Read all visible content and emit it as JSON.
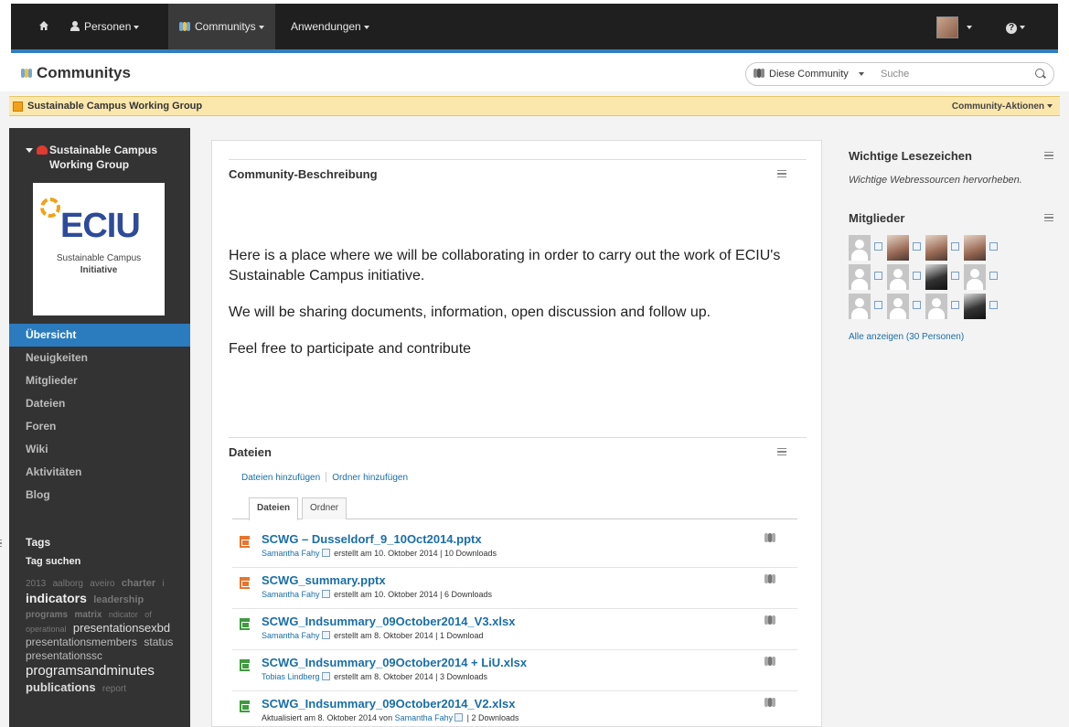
{
  "nav": {
    "items": [
      "Personen",
      "Communitys",
      "Anwendungen"
    ],
    "help_label": "?"
  },
  "header": {
    "title": "Communitys",
    "search_scope": "Diese Community",
    "search_placeholder": "Suche"
  },
  "banner": {
    "community_name": "Sustainable Campus Working Group",
    "actions_label": "Community-Aktionen"
  },
  "sidebar": {
    "community_title": "Sustainable Campus Working Group",
    "logo": {
      "brand": "ECIU",
      "line1": "Sustainable Campus",
      "line2": "Initiative"
    },
    "nav": [
      "Übersicht",
      "Neuigkeiten",
      "Mitglieder",
      "Dateien",
      "Foren",
      "Wiki",
      "Aktivitäten",
      "Blog"
    ],
    "tags_heading": "Tags",
    "tag_search": "Tag suchen",
    "tags": [
      {
        "t": "2013",
        "s": 10
      },
      {
        "t": "aalborg",
        "s": 10
      },
      {
        "t": "aveiro",
        "s": 10
      },
      {
        "t": "charter",
        "s": 11,
        "b": true
      },
      {
        "t": "i",
        "s": 10
      },
      {
        "t": "indicators",
        "s": 14,
        "b": true,
        "c": "#eee"
      },
      {
        "t": "leadership",
        "s": 11,
        "b": true
      },
      {
        "t": "programs",
        "s": 10,
        "b": true
      },
      {
        "t": "matrix",
        "s": 10,
        "b": true
      },
      {
        "t": "ndicator",
        "s": 9
      },
      {
        "t": "of",
        "s": 9
      },
      {
        "t": "operational",
        "s": 9
      },
      {
        "t": "presentationsexbd",
        "s": 13,
        "c": "#ddd"
      },
      {
        "t": "presentationsmembers",
        "s": 12,
        "c": "#bbb"
      },
      {
        "t": "status",
        "s": 12,
        "c": "#bbb"
      },
      {
        "t": "presentationssc",
        "s": 12,
        "c": "#bbb"
      },
      {
        "t": "programsandminutes",
        "s": 15,
        "c": "#eee"
      },
      {
        "t": "publications",
        "s": 13,
        "b": true,
        "c": "#ddd"
      },
      {
        "t": "report",
        "s": 10
      }
    ]
  },
  "main": {
    "description_heading": "Community-Beschreibung",
    "description": [
      "Here is a place where we will be collaborating in order to carry out the work of ECIU's Sustainable Campus initiative.",
      "We will be sharing documents, information, open discussion and follow up.",
      "Feel free to participate and contribute"
    ],
    "files_heading": "Dateien",
    "add_files": "Dateien hinzufügen",
    "add_folder": "Ordner hinzufügen",
    "tabs": [
      "Dateien",
      "Ordner"
    ],
    "files": [
      {
        "type": "pptx",
        "name": "SCWG – Dusseldorf_9_10Oct2014.pptx",
        "pre": "",
        "who": "Samantha Fahy",
        "post": "erstellt am 10. Oktober 2014 | 10 Downloads"
      },
      {
        "type": "pptx",
        "name": "SCWG_summary.pptx",
        "pre": "",
        "who": "Samantha Fahy",
        "post": "erstellt am 10. Oktober 2014 | 6 Downloads"
      },
      {
        "type": "xlsx",
        "name": "SCWG_Indsummary_09October2014_V3.xlsx",
        "pre": "",
        "who": "Samantha Fahy",
        "post": "erstellt am 8. Oktober 2014 | 1 Download"
      },
      {
        "type": "xlsx",
        "name": "SCWG_Indsummary_09October2014 + LiU.xlsx",
        "pre": "",
        "who": "Tobias Lindberg",
        "post": "erstellt am 8. Oktober 2014 | 3 Downloads"
      },
      {
        "type": "xlsx",
        "name": "SCWG_Indsummary_09October2014_V2.xlsx",
        "pre": "Aktualisiert am 8. Oktober 2014 von",
        "who": "Samantha Fahy",
        "post": "| 2 Downloads"
      }
    ]
  },
  "right": {
    "bookmarks_heading": "Wichtige Lesezeichen",
    "bookmarks_desc": "Wichtige Webressourcen hervorheben.",
    "members_heading": "Mitglieder",
    "members": [
      "blank",
      "photo",
      "photo",
      "photo",
      "blank",
      "blank",
      "photo-dark",
      "blank",
      "blank",
      "blank",
      "blank",
      "photo-dark"
    ],
    "all_link": "Alle anzeigen (30 Personen)"
  },
  "colors": {
    "nav_bg": "#1f1f1f",
    "accent": "#2b7bbf",
    "banner": "#fbe7ac",
    "sidebar_bg": "#333333",
    "link": "#1a6ea8"
  }
}
